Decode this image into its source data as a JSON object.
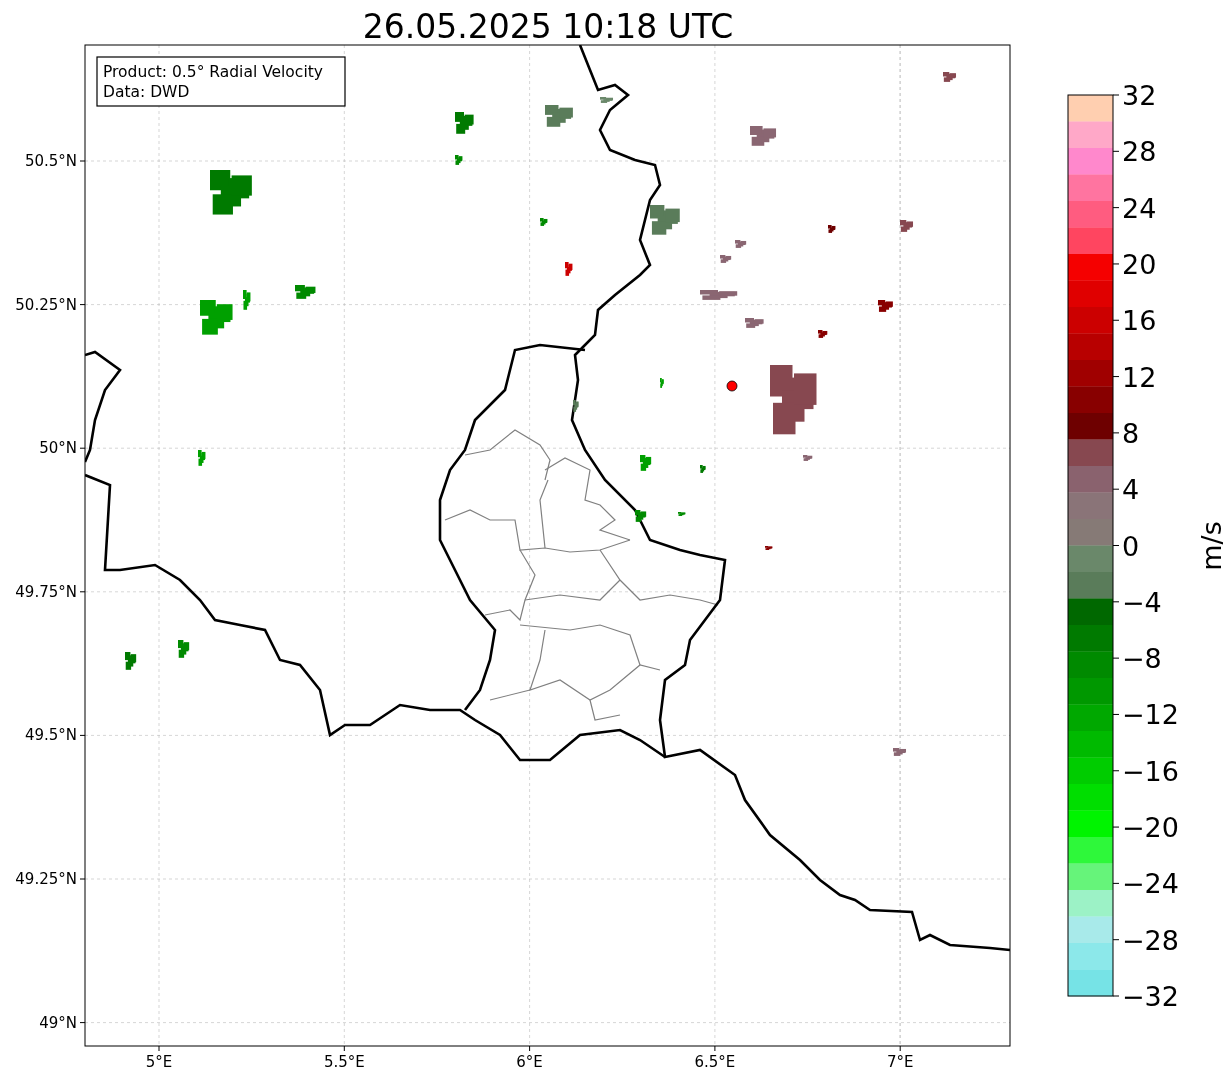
{
  "title": "26.05.2025 10:18 UTC",
  "info_box": [
    "Product: 0.5° Radial Velocity",
    "Data: DWD"
  ],
  "lat_ticks": [
    "50.5°N",
    "50.25°N",
    "50°N",
    "49.75°N",
    "49.5°N",
    "49.25°N",
    "49°N"
  ],
  "lon_ticks": [
    "5°E",
    "5.5°E",
    "6°E",
    "6.5°E",
    "7°E"
  ],
  "colorbar": {
    "label": "m/s",
    "ticks": [
      "32",
      "28",
      "24",
      "20",
      "16",
      "12",
      "8",
      "4",
      "0",
      "−4",
      "−8",
      "−12",
      "−16",
      "−20",
      "−24",
      "−28",
      "−32"
    ],
    "bands": [
      {
        "color": "#ffcfb0"
      },
      {
        "color": "#ffa8c8"
      },
      {
        "color": "#ff88cc"
      },
      {
        "color": "#ff74a0"
      },
      {
        "color": "#ff5c80"
      },
      {
        "color": "#ff4560"
      },
      {
        "color": "#f50000"
      },
      {
        "color": "#e00000"
      },
      {
        "color": "#cc0000"
      },
      {
        "color": "#b80000"
      },
      {
        "color": "#a00000"
      },
      {
        "color": "#880000"
      },
      {
        "color": "#6e0000"
      },
      {
        "color": "#874850"
      },
      {
        "color": "#8a626e"
      },
      {
        "color": "#8a7478"
      },
      {
        "color": "#867a76"
      },
      {
        "color": "#6a886a"
      },
      {
        "color": "#5a7c5a"
      },
      {
        "color": "#006800"
      },
      {
        "color": "#007a00"
      },
      {
        "color": "#008a00"
      },
      {
        "color": "#009800"
      },
      {
        "color": "#00a800"
      },
      {
        "color": "#00ba00"
      },
      {
        "color": "#00cc00"
      },
      {
        "color": "#00de00"
      },
      {
        "color": "#00f400"
      },
      {
        "color": "#2ef83a"
      },
      {
        "color": "#66f47a"
      },
      {
        "color": "#9cf2c6"
      },
      {
        "color": "#a8eaea"
      },
      {
        "color": "#8ce8ea"
      },
      {
        "color": "#76e3e6"
      }
    ]
  }
}
